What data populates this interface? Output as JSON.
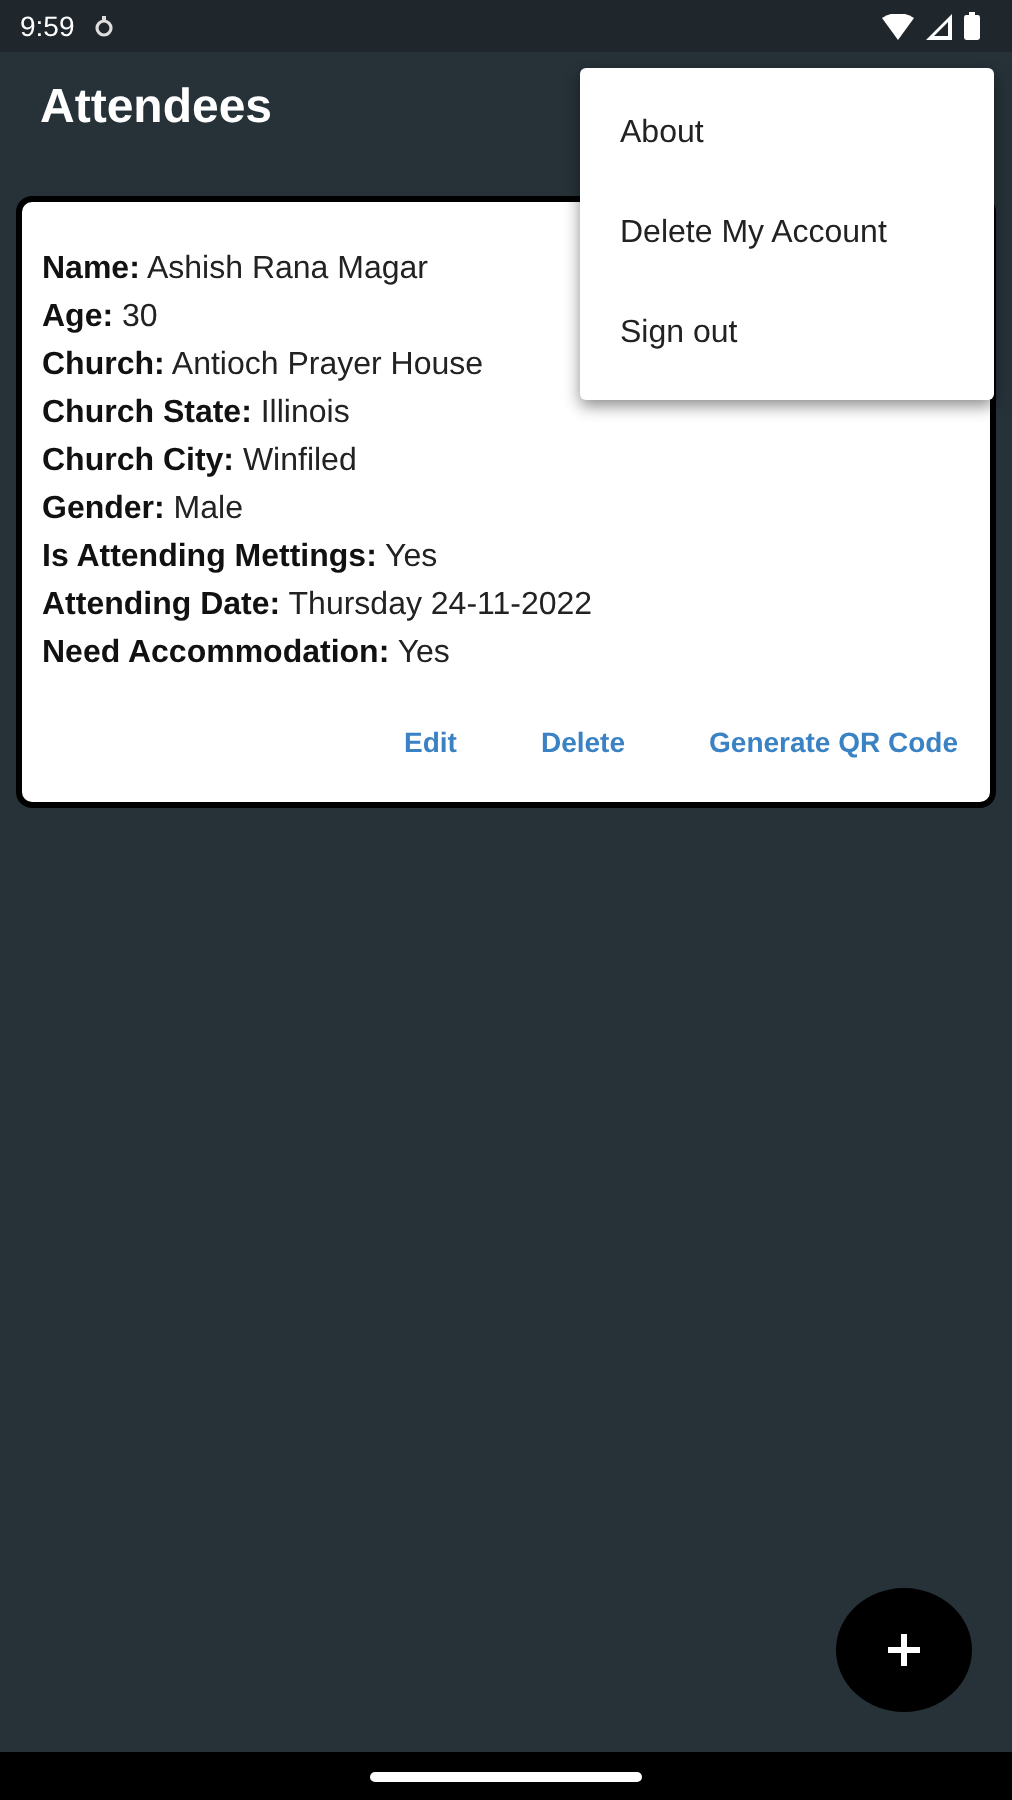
{
  "status_bar": {
    "time": "9:59"
  },
  "app_bar": {
    "title": "Attendees"
  },
  "attendees": [
    {
      "fields": [
        {
          "label": "Name:",
          "value": "Ashish Rana Magar"
        },
        {
          "label": "Age:",
          "value": "30"
        },
        {
          "label": "Church:",
          "value": "Antioch Prayer House"
        },
        {
          "label": "Church State:",
          "value": "Illinois"
        },
        {
          "label": "Church City:",
          "value": "Winfiled"
        },
        {
          "label": "Gender:",
          "value": "Male"
        },
        {
          "label": "Is Attending Mettings:",
          "value": "Yes"
        },
        {
          "label": "Attending Date:",
          "value": "Thursday 24-11-2022"
        },
        {
          "label": "Need Accommodation:",
          "value": "Yes"
        }
      ],
      "actions": [
        "Edit",
        "Delete",
        "Generate QR Code"
      ]
    }
  ],
  "menu": {
    "items": [
      "About",
      "Delete My Account",
      "Sign out"
    ]
  }
}
